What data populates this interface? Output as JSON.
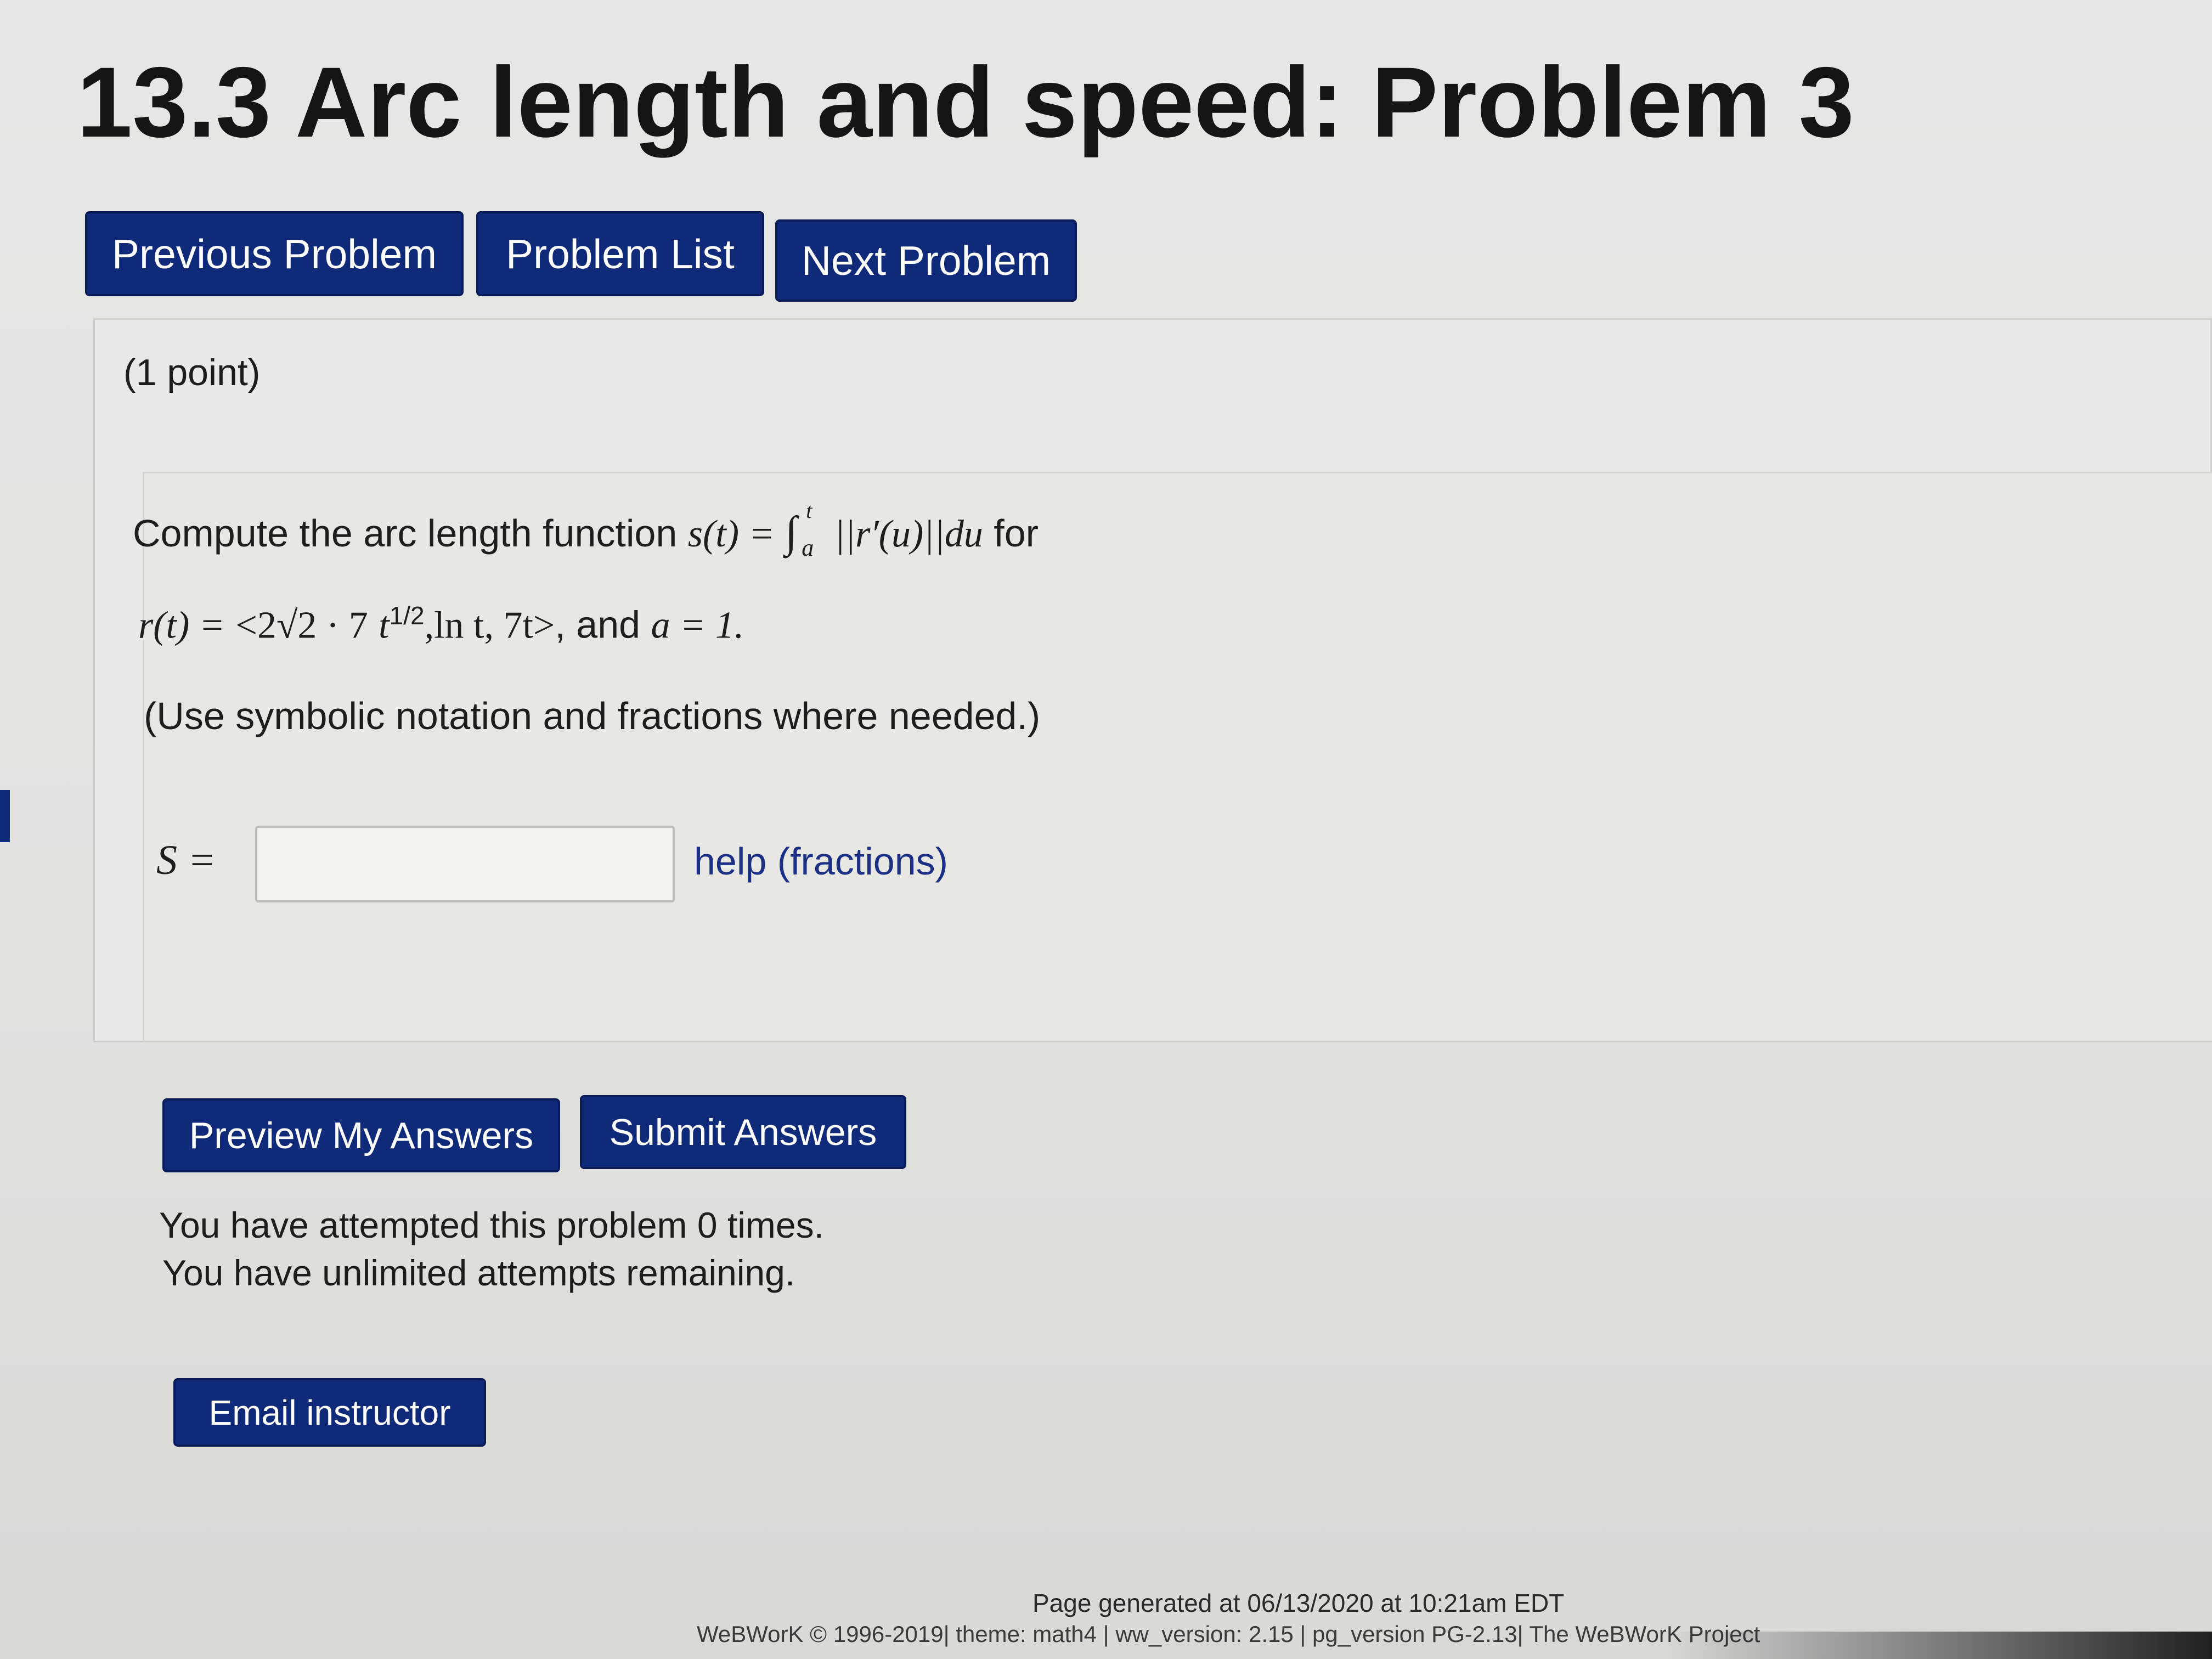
{
  "page": {
    "title": "13.3 Arc length and speed: Problem 3"
  },
  "nav": {
    "previous_label": "Previous Problem",
    "list_label": "Problem List",
    "next_label": "Next Problem"
  },
  "problem": {
    "points": "(1 point)",
    "intro_text": "Compute the arc length function",
    "s_of_t": "s(t) =",
    "integral_sign": "∫",
    "upper_limit": "t",
    "lower_limit": "a",
    "integrand": "||r′(u)||du",
    "for_text": "for",
    "r_of_t": "r(t) =",
    "vector_open": "<2√2 · 7",
    "t_power_base": "t",
    "t_power_exp": "1/2",
    "vector_rest": ",ln t, 7t>",
    "and_text": ", and",
    "a_equals": "a = 1.",
    "instructions": "(Use symbolic notation and fractions where needed.)",
    "answer_label": "S =",
    "answer_value": "",
    "help_link": "help (fractions)"
  },
  "actions": {
    "preview_label": "Preview My Answers",
    "submit_label": "Submit Answers",
    "attempts_text": "You have attempted this problem 0 times.",
    "remaining_text": "You have unlimited attempts remaining.",
    "email_label": "Email instructor"
  },
  "footer": {
    "generated": "Page generated at 06/13/2020 at 10:21am EDT",
    "credits": "WeBWorK © 1996-2019| theme: math4 | ww_version: 2.15 | pg_version PG-2.13| The WeBWorK Project"
  },
  "colors": {
    "button_bg": "#102a7a",
    "link": "#1a2f85",
    "background": "#e4e4e1"
  }
}
